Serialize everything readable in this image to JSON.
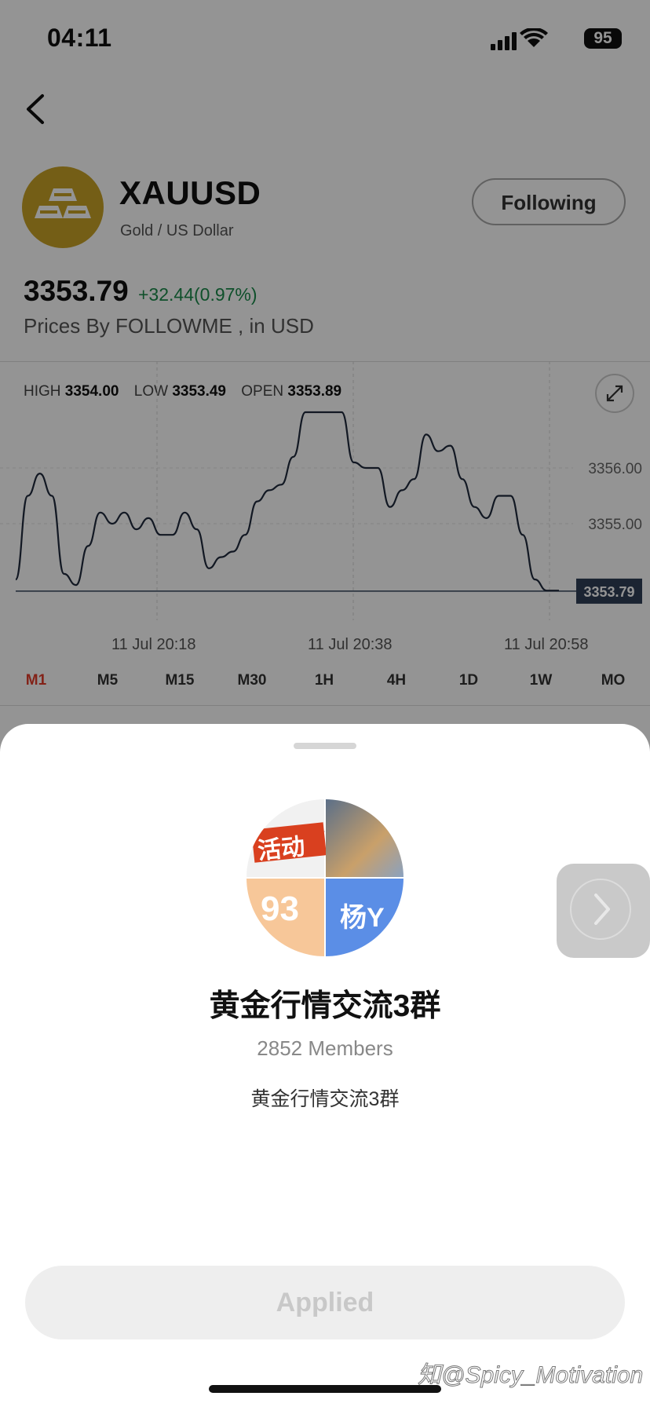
{
  "status_bar": {
    "time": "04:11",
    "battery": "95"
  },
  "header": {
    "back_icon": "chevron-left-icon"
  },
  "instrument": {
    "symbol": "XAUUSD",
    "name": "Gold / US Dollar",
    "avatar_icon": "gold-bars-icon",
    "avatar_color": "#c9a227",
    "follow_label": "Following",
    "price": "3353.79",
    "change": "+32.44(0.97%)",
    "change_color": "#1a8a4a",
    "prices_by": "Prices By FOLLOWME , in USD"
  },
  "chart": {
    "stats": [
      {
        "label": "HIGH",
        "value": "3354.00"
      },
      {
        "label": "LOW",
        "value": "3353.49"
      },
      {
        "label": "OPEN",
        "value": "3353.89"
      }
    ],
    "y_ticks": [
      "3356.00",
      "3355.00"
    ],
    "current_price_tag": "3353.79",
    "x_ticks": [
      "11 Jul 20:18",
      "11 Jul 20:38",
      "11 Jul 20:58"
    ],
    "expand_icon": "expand-icon",
    "timeframes": [
      "M1",
      "M5",
      "M15",
      "M30",
      "1H",
      "4H",
      "1D",
      "1W",
      "MO"
    ],
    "active_timeframe": "M1",
    "active_color": "#e23b2a"
  },
  "chart_data": {
    "type": "line",
    "title": "",
    "xlabel": "",
    "ylabel": "",
    "y_ticks": [
      3355.0,
      3356.0
    ],
    "x_ticks": [
      "11 Jul 20:18",
      "11 Jul 20:38",
      "11 Jul 20:58"
    ],
    "reference_line": 3353.79,
    "series": [
      {
        "values": [
          3354.0,
          3355.5,
          3355.9,
          3355.5,
          3354.1,
          3353.9,
          3354.6,
          3355.2,
          3355.0,
          3355.2,
          3354.9,
          3355.1,
          3354.8,
          3354.8,
          3355.2,
          3354.9,
          3354.2,
          3354.4,
          3354.5,
          3354.8,
          3355.4,
          3355.6,
          3355.7,
          3356.2,
          3357.0,
          3357.0,
          3357.0,
          3357.0,
          3356.1,
          3356.0,
          3356.0,
          3355.3,
          3355.6,
          3355.8,
          3356.6,
          3356.3,
          3356.4,
          3355.8,
          3355.3,
          3355.1,
          3355.5,
          3355.5,
          3354.8,
          3354.0,
          3353.8,
          3353.8
        ]
      }
    ]
  },
  "group": {
    "avatar_tiles": [
      "活动",
      "93",
      "杨Y"
    ],
    "name": "黄金行情交流3群",
    "members": "2852 Members",
    "description": "黄金行情交流3群",
    "next_icon": "chevron-right-icon",
    "button_label": "Applied"
  },
  "watermark": "知@Spicy_Motivation"
}
